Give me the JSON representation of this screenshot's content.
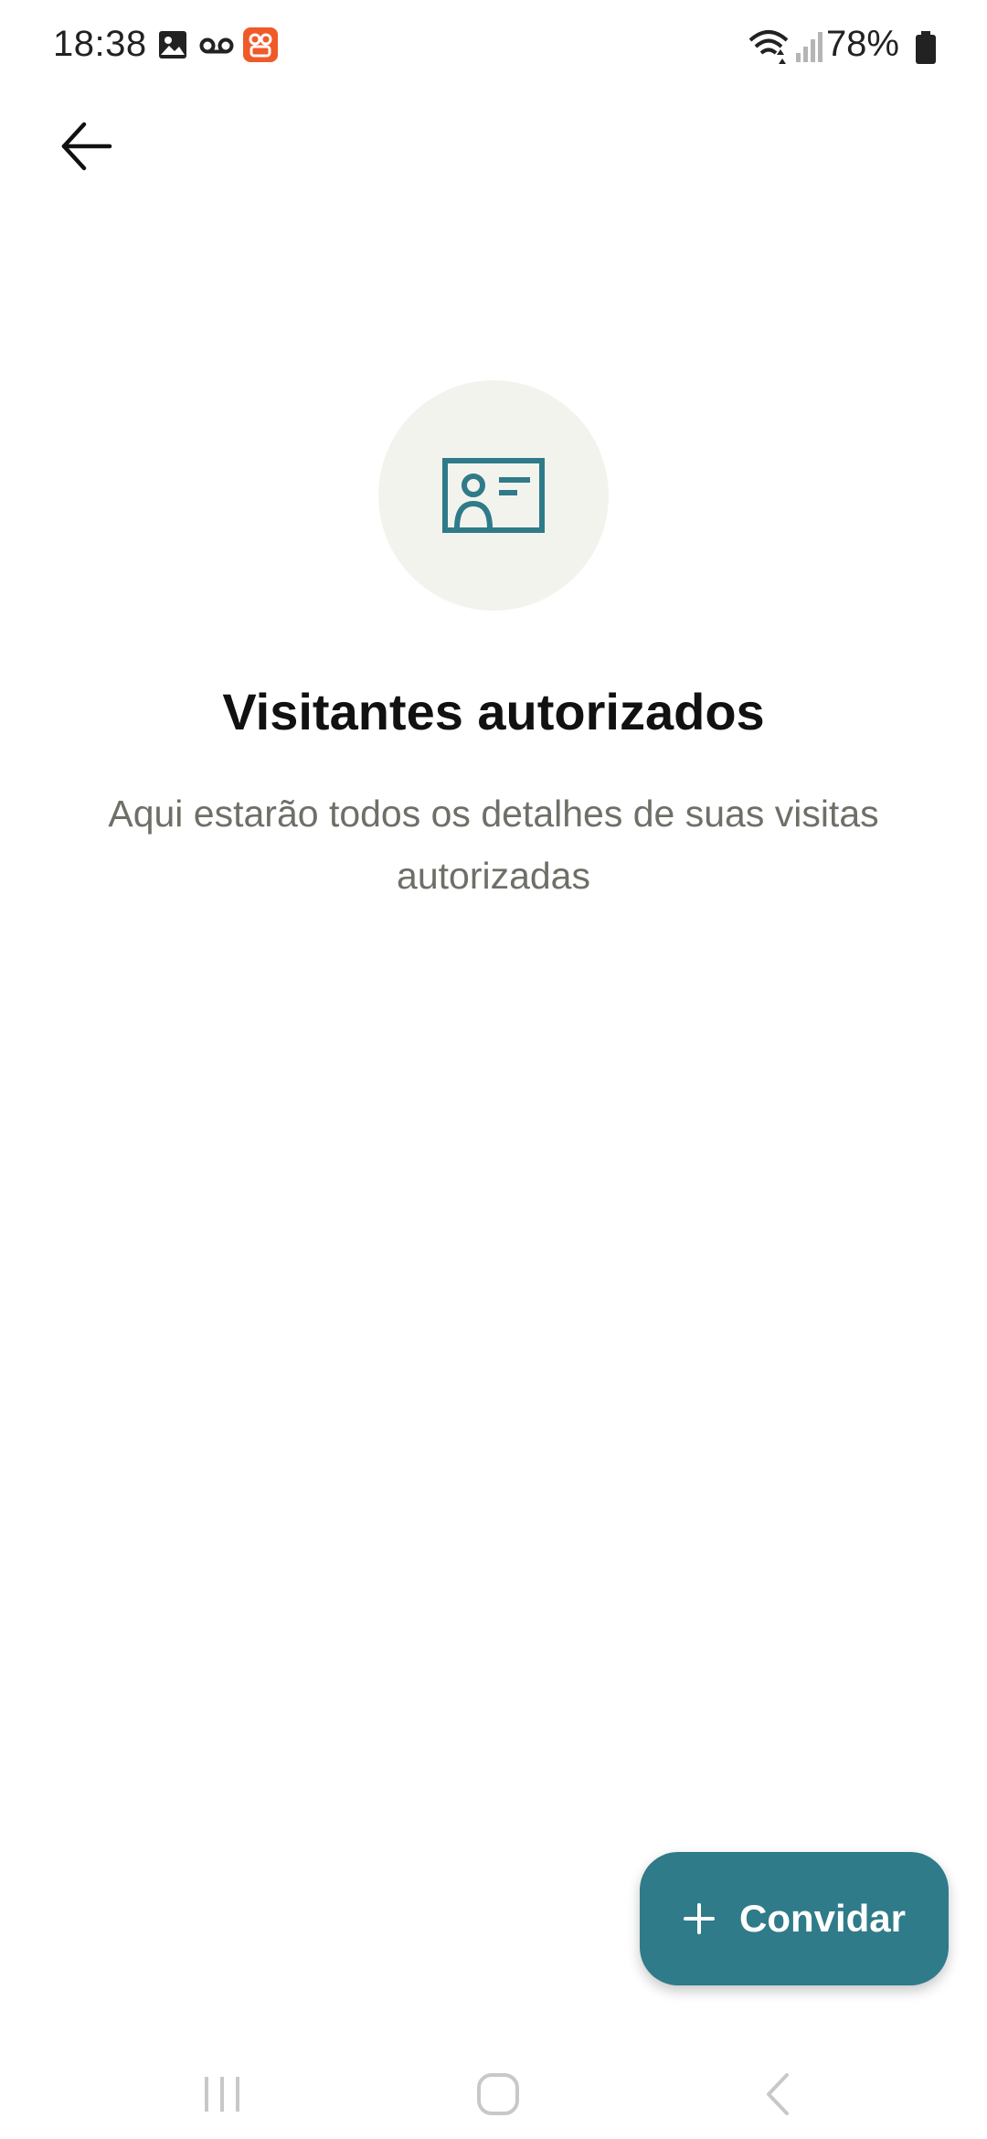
{
  "status_bar": {
    "time": "18:38",
    "battery": "78%",
    "icons": [
      "image-icon",
      "voicemail-icon",
      "app-notification-icon",
      "wifi-icon",
      "signal-icon",
      "battery-icon"
    ]
  },
  "top_bar": {
    "back_icon": "arrow-left-icon"
  },
  "empty_state": {
    "icon": "id-card-icon",
    "title": "Visitantes autorizados",
    "description": "Aqui estarão todos os detalhes de suas visitas autorizadas"
  },
  "fab": {
    "icon": "plus-icon",
    "label": "Convidar"
  },
  "colors": {
    "accent": "#2f7b89",
    "icon_circle_bg": "#f3f3ee",
    "title_text": "#111111",
    "description_text": "#6f6f68",
    "notification_badge": "#f05a28"
  },
  "nav_bar": {
    "items": [
      "recents-icon",
      "home-icon",
      "back-icon"
    ]
  }
}
